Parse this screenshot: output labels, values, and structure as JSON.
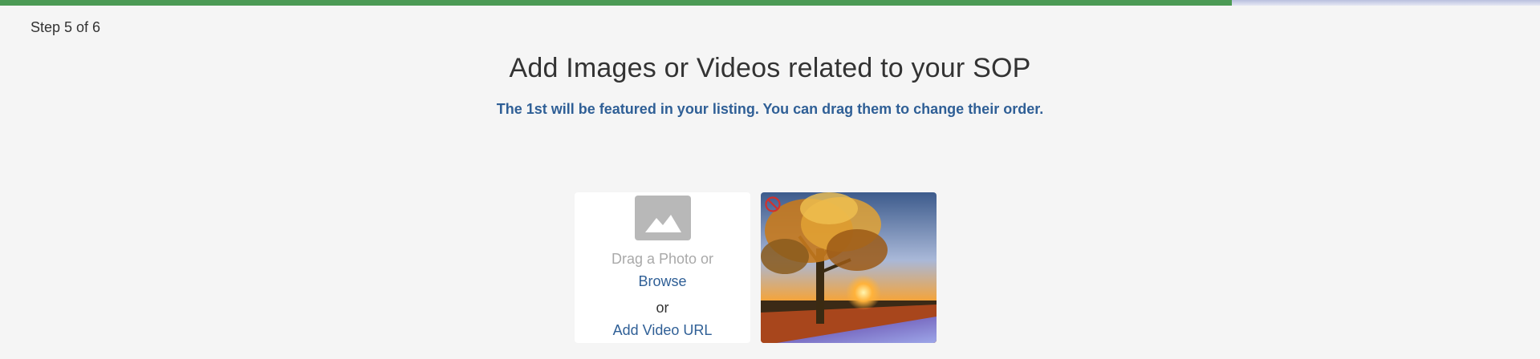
{
  "progress": {
    "step_label": "Step 5 of 6",
    "completed_fraction": 0.8,
    "fill_color": "#4c9a55",
    "track_color": "#c5cae6"
  },
  "header": {
    "title": "Add Images or Videos related to your SOP",
    "subtitle": "The 1st will be featured in your listing. You can drag them to change their order."
  },
  "uploader": {
    "placeholder_icon": "image-placeholder-icon",
    "drag_text": "Drag a Photo or",
    "browse_label": "Browse",
    "or_text": "or",
    "video_url_label": "Add Video URL"
  },
  "media": {
    "items": [
      {
        "kind": "image",
        "description_icon": "tree-sunset-thumbnail",
        "remove_icon": "remove-icon"
      }
    ]
  },
  "colors": {
    "accent": "#2f5f96",
    "background": "#f5f5f5",
    "remove": "#d0312d"
  }
}
